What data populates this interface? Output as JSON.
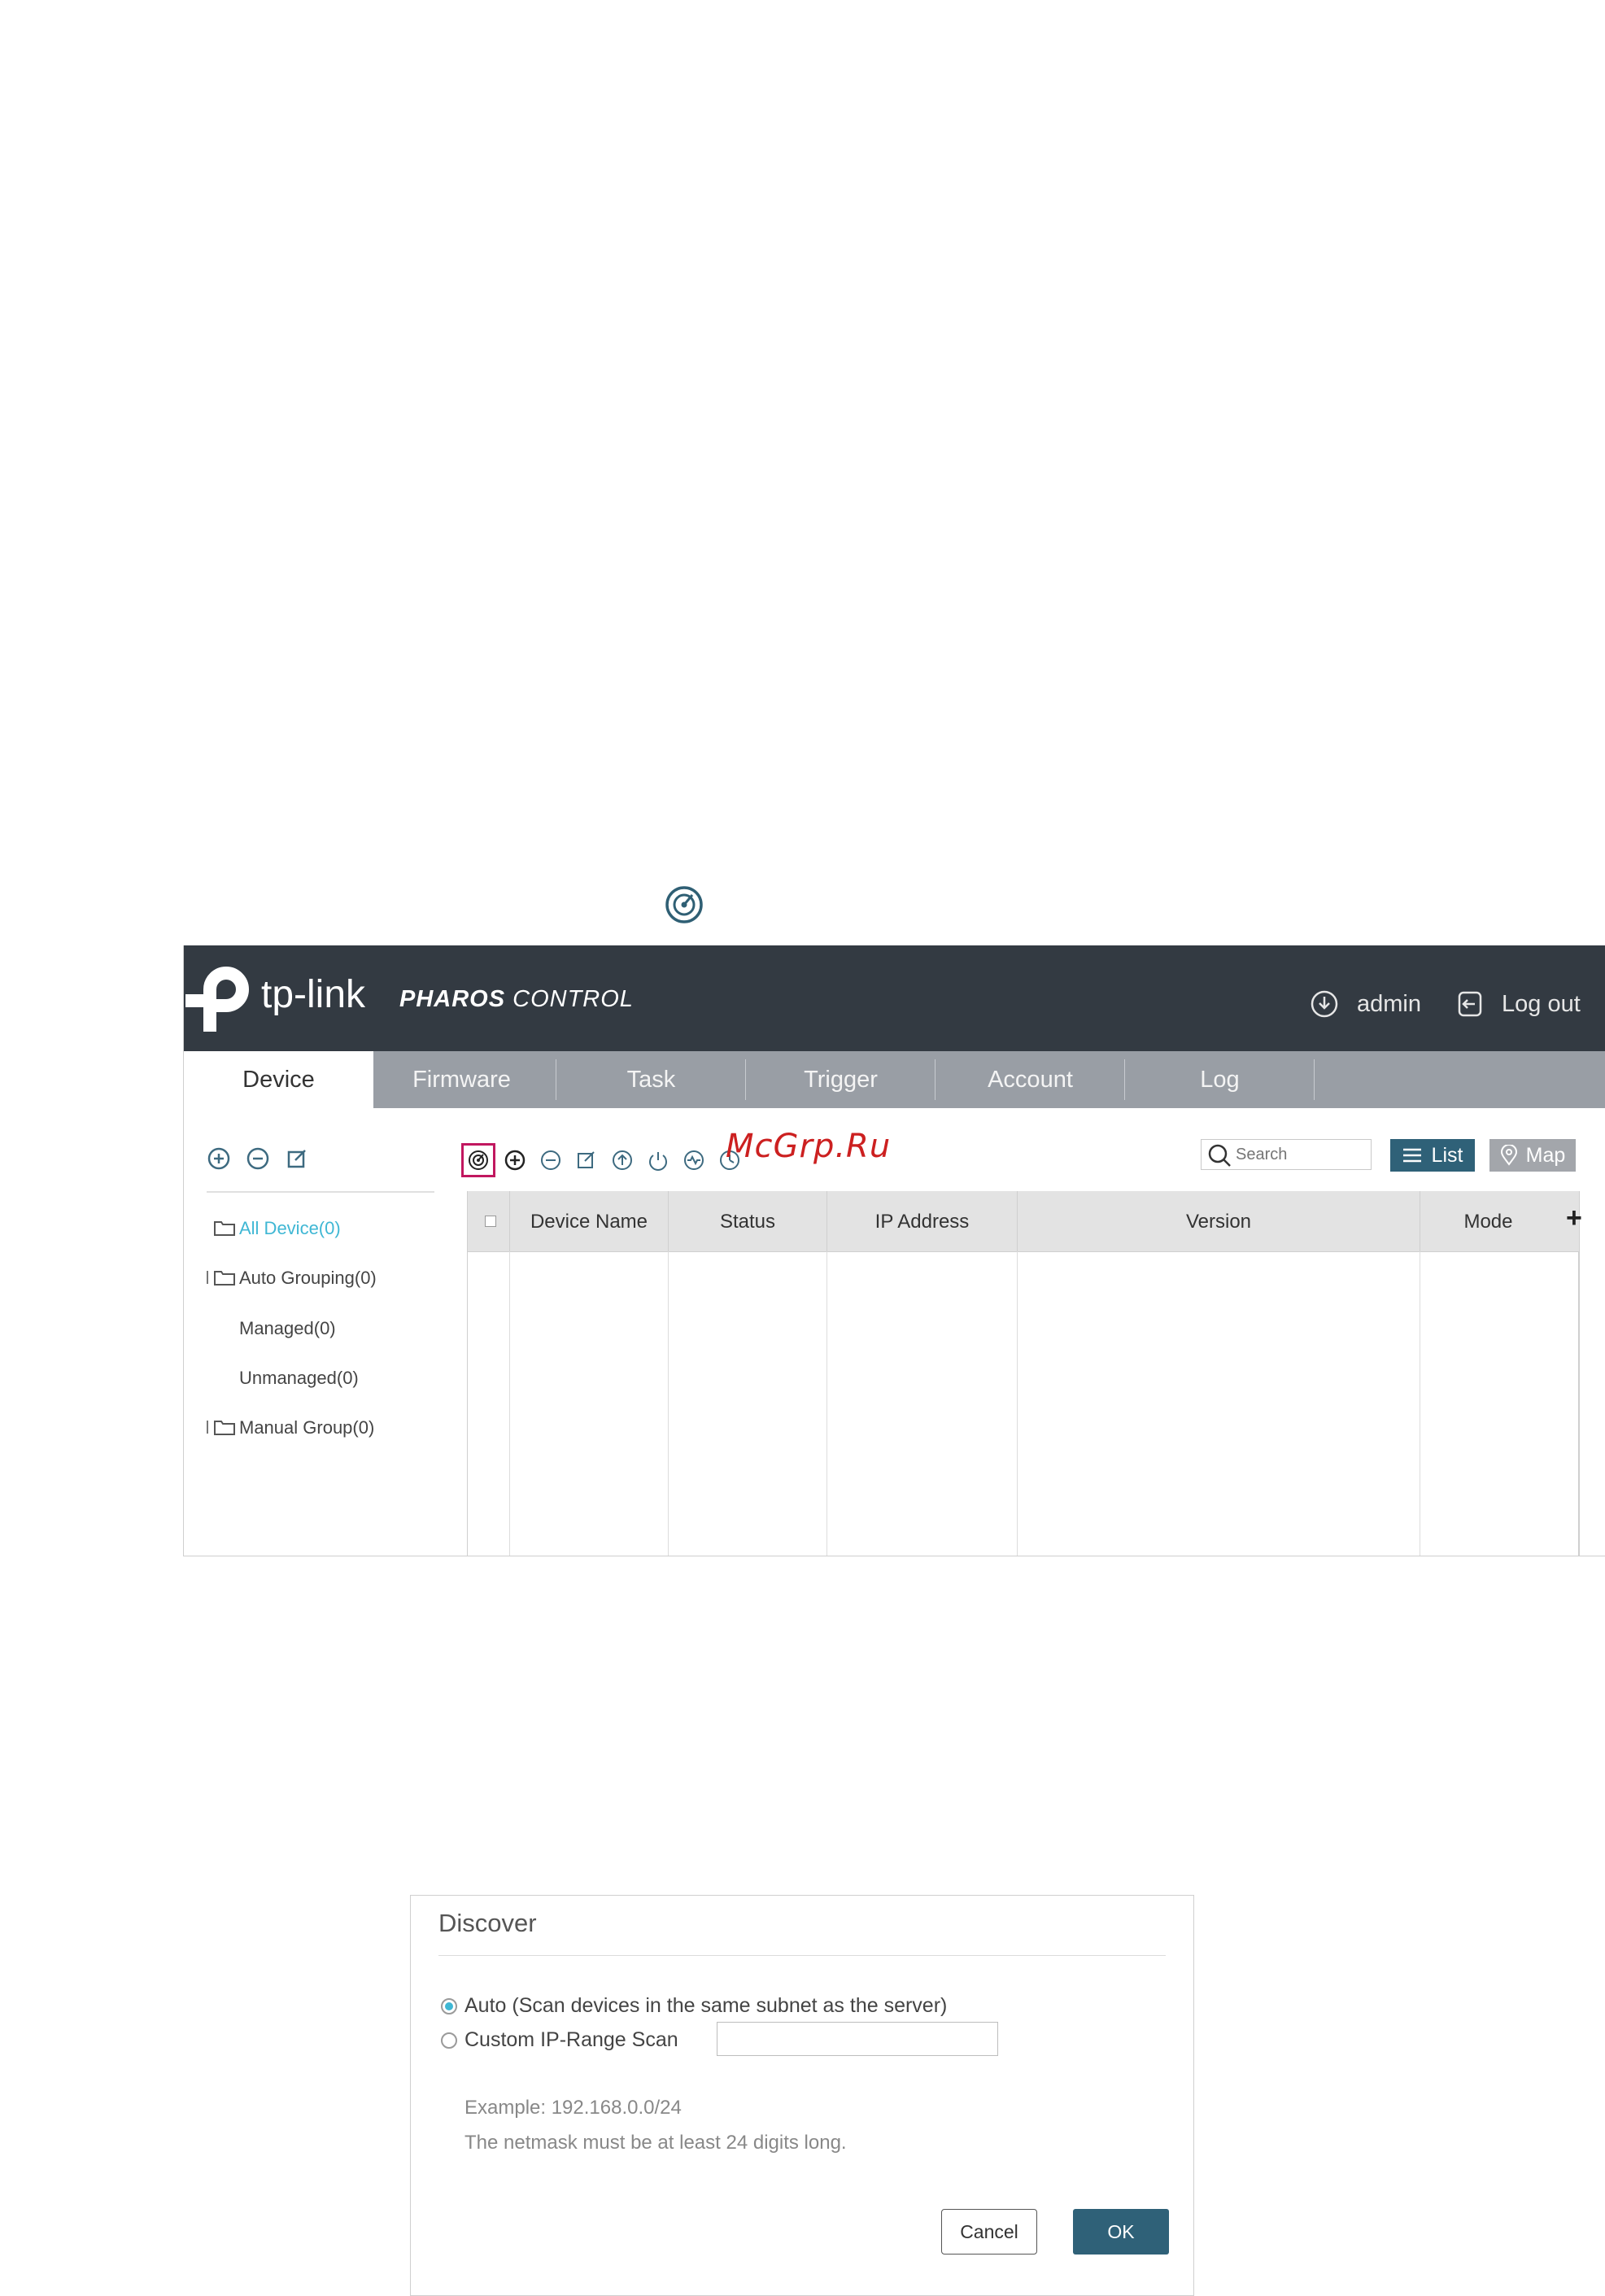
{
  "header": {
    "logo_text": "tp-link",
    "product_bold": "PHAROS",
    "product_light": " CONTROL",
    "user": "admin",
    "logout": "Log out"
  },
  "tabs": [
    {
      "label": "Device",
      "active": true
    },
    {
      "label": "Firmware"
    },
    {
      "label": "Task"
    },
    {
      "label": "Trigger"
    },
    {
      "label": "Account"
    },
    {
      "label": "Log"
    }
  ],
  "sidebar": {
    "tools": [
      "add-icon",
      "remove-icon",
      "edit-icon"
    ],
    "items": [
      {
        "label": "All Device(0)",
        "active": true
      },
      {
        "label": "Auto Grouping(0)"
      },
      {
        "label": "Managed(0)"
      },
      {
        "label": "Unmanaged(0)"
      },
      {
        "label": "Manual Group(0)"
      }
    ]
  },
  "toolbar": {
    "icons": [
      "discover-icon",
      "add-icon",
      "remove-icon",
      "edit-icon",
      "upgrade-icon",
      "reboot-icon",
      "monitor-icon",
      "clock-icon"
    ],
    "watermark": "McGrp.Ru",
    "search_placeholder": "Search",
    "list_label": "List",
    "map_label": "Map"
  },
  "table": {
    "columns": [
      "Device Name",
      "Status",
      "IP Address",
      "Version",
      "Mode"
    ],
    "add_column": "+",
    "rows": []
  },
  "dialog": {
    "title": "Discover",
    "option_auto": "Auto (Scan devices in the same subnet as the server)",
    "option_custom": "Custom IP-Range Scan",
    "custom_value": "",
    "example": "Example: 192.168.0.0/24",
    "netmask_note": "The netmask must be at least 24 digits long.",
    "cancel": "Cancel",
    "ok": "OK"
  },
  "colors": {
    "topbar": "#333a42",
    "tabbar": "#999ea5",
    "accent": "#2f6178",
    "active_link": "#3fb7d4",
    "highlight_box": "#c1175f"
  }
}
